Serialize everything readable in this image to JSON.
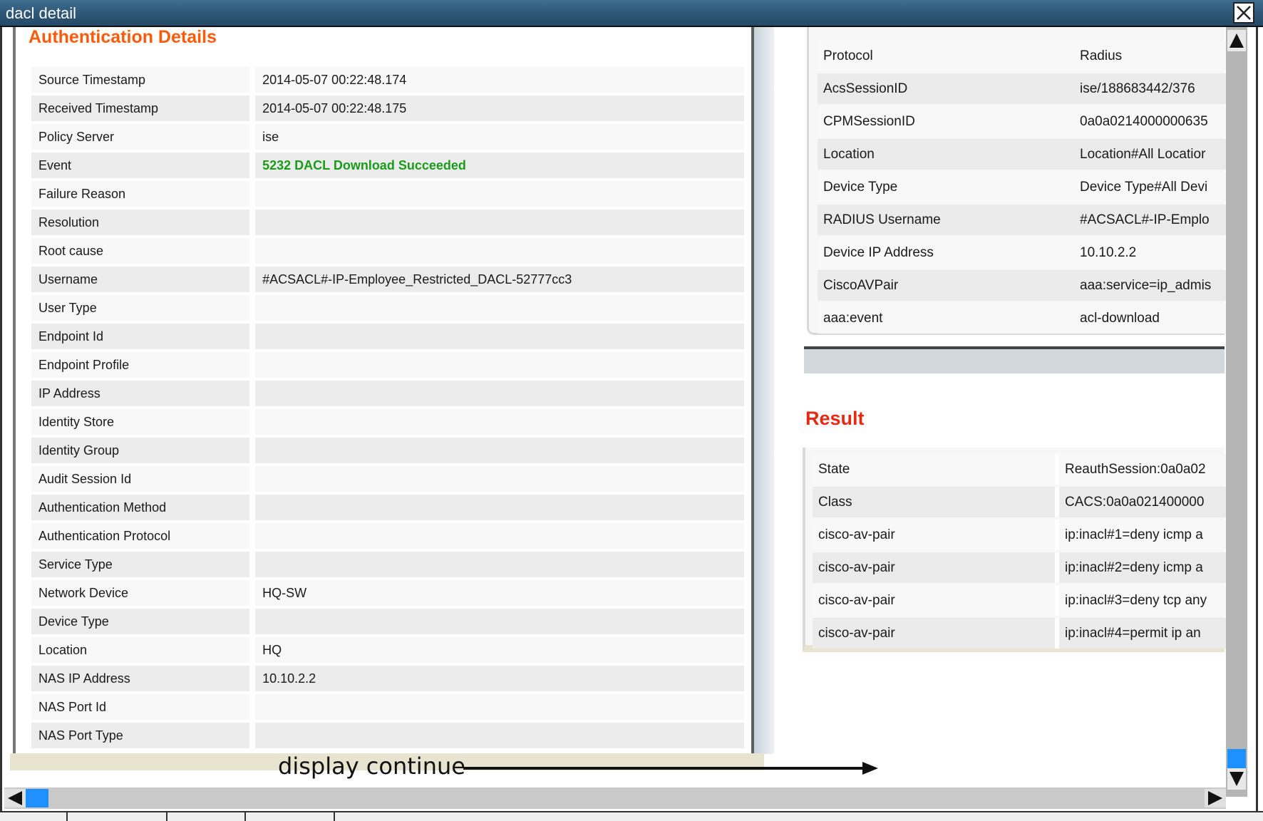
{
  "window": {
    "title": "dacl detail"
  },
  "auth_details": {
    "title": "Authentication Details",
    "rows": [
      {
        "key": "Source Timestamp",
        "value": "2014-05-07 00:22:48.174"
      },
      {
        "key": "Received Timestamp",
        "value": "2014-05-07 00:22:48.175"
      },
      {
        "key": "Policy Server",
        "value": "ise"
      },
      {
        "key": "Event",
        "value": "5232 DACL Download Succeeded"
      },
      {
        "key": "Failure Reason",
        "value": ""
      },
      {
        "key": "Resolution",
        "value": ""
      },
      {
        "key": "Root cause",
        "value": ""
      },
      {
        "key": "Username",
        "value": "#ACSACL#-IP-Employee_Restricted_DACL-52777cc3"
      },
      {
        "key": "User Type",
        "value": ""
      },
      {
        "key": "Endpoint Id",
        "value": ""
      },
      {
        "key": "Endpoint Profile",
        "value": ""
      },
      {
        "key": "IP Address",
        "value": ""
      },
      {
        "key": "Identity Store",
        "value": ""
      },
      {
        "key": "Identity Group",
        "value": ""
      },
      {
        "key": "Audit Session Id",
        "value": ""
      },
      {
        "key": "Authentication Method",
        "value": ""
      },
      {
        "key": "Authentication Protocol",
        "value": ""
      },
      {
        "key": "Service Type",
        "value": ""
      },
      {
        "key": "Network Device",
        "value": "HQ-SW"
      },
      {
        "key": "Device Type",
        "value": ""
      },
      {
        "key": "Location",
        "value": "HQ"
      },
      {
        "key": "NAS IP Address",
        "value": "10.10.2.2"
      },
      {
        "key": "NAS Port Id",
        "value": ""
      },
      {
        "key": "NAS Port Type",
        "value": ""
      }
    ]
  },
  "other_attributes": {
    "rows": [
      {
        "key": "Protocol",
        "value": "Radius"
      },
      {
        "key": "AcsSessionID",
        "value": "ise/188683442/376"
      },
      {
        "key": "CPMSessionID",
        "value": "0a0a0214000000635"
      },
      {
        "key": "Location",
        "value": "Location#All Locatior"
      },
      {
        "key": "Device Type",
        "value": "Device Type#All Devi"
      },
      {
        "key": "RADIUS Username",
        "value": "#ACSACL#-IP-Emplo"
      },
      {
        "key": "Device IP Address",
        "value": "10.10.2.2"
      },
      {
        "key": "CiscoAVPair",
        "value": "aaa:service=ip_admis"
      },
      {
        "key": "aaa:event",
        "value": "acl-download"
      }
    ]
  },
  "result": {
    "title": "Result",
    "rows": [
      {
        "key": "State",
        "value": "ReauthSession:0a0a02"
      },
      {
        "key": "Class",
        "value": "CACS:0a0a021400000"
      },
      {
        "key": "cisco-av-pair",
        "value": "ip:inacl#1=deny icmp a"
      },
      {
        "key": "cisco-av-pair",
        "value": "ip:inacl#2=deny icmp a"
      },
      {
        "key": "cisco-av-pair",
        "value": "ip:inacl#3=deny tcp any"
      },
      {
        "key": "cisco-av-pair",
        "value": "ip:inacl#4=permit ip an"
      }
    ]
  },
  "annotation": {
    "text": "display continue"
  },
  "colors": {
    "titlebar": "#2f5878",
    "section_title_orange": "#ff5a0a",
    "result_title_red": "#e62a12",
    "event_success_green": "#1a9b1a",
    "scroll_thumb_blue": "#1e90ff"
  },
  "icons": {
    "close": "close-icon",
    "scroll_up": "arrow-up-icon",
    "scroll_down": "arrow-down-icon",
    "scroll_left": "arrow-left-icon",
    "scroll_right": "arrow-right-icon"
  }
}
